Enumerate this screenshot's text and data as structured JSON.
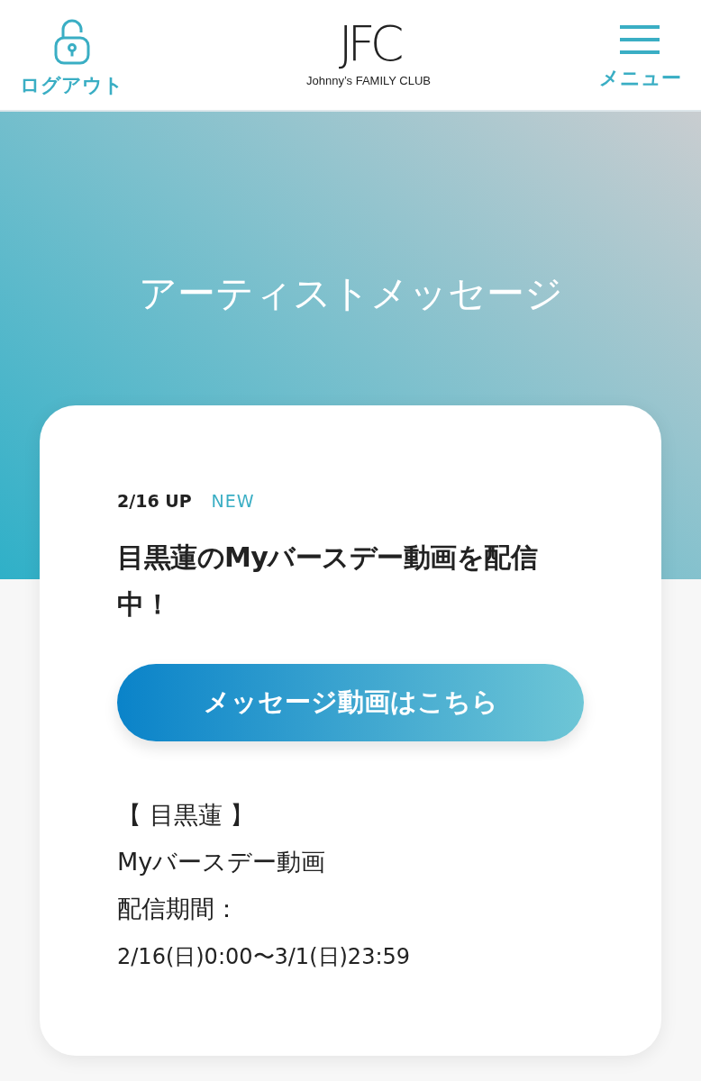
{
  "header": {
    "logout_label": "ログアウト",
    "logo_mark": "JFC",
    "logo_text": "Johnny’s FAMILY CLUB",
    "menu_label": "メニュー"
  },
  "hero": {
    "title": "アーティストメッセージ"
  },
  "card": {
    "date": "2/16 UP",
    "is_new": true,
    "new_label": "NEW",
    "title": "目黒蓮のMyバースデー動画を配信中！",
    "button": "メッセージ動画はこちら",
    "details": [
      "【 目黒蓮 】",
      "Myバースデー動画",
      "配信期間：",
      "2/16(日)0:00〜3/1(日)23:59"
    ]
  }
}
